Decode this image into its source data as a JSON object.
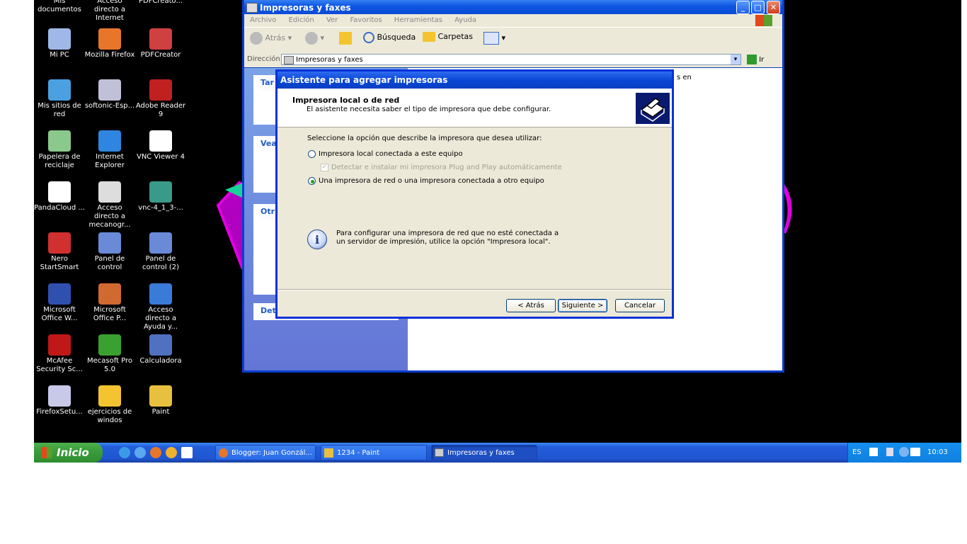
{
  "desktop": {
    "icons": [
      {
        "label": "Mis documentos",
        "icon": "my-documents-icon"
      },
      {
        "label": "Acceso directo a Internet",
        "icon": "internet-shortcut-icon"
      },
      {
        "label": "PDFCreato...",
        "icon": "pdfcreator-icon"
      },
      {
        "label": "Mi PC",
        "icon": "my-computer-icon"
      },
      {
        "label": "Mozilla Firefox",
        "icon": "firefox-icon"
      },
      {
        "label": "PDFCreator",
        "icon": "pdfcreator-icon"
      },
      {
        "label": "Mis sitios de red",
        "icon": "network-places-icon"
      },
      {
        "label": "softonic-Esp...",
        "icon": "installer-icon"
      },
      {
        "label": "Adobe Reader 9",
        "icon": "adobe-reader-icon"
      },
      {
        "label": "Papelera de reciclaje",
        "icon": "recycle-bin-icon"
      },
      {
        "label": "Internet Explorer",
        "icon": "internet-explorer-icon"
      },
      {
        "label": "VNC Viewer 4",
        "icon": "vnc-icon"
      },
      {
        "label": "PandaCloud ...",
        "icon": "panda-icon"
      },
      {
        "label": "Acceso directo a mecanogr...",
        "icon": "mecanografia-icon"
      },
      {
        "label": "vnc-4_1_3-...",
        "icon": "archive-icon"
      },
      {
        "label": "Nero StartSmart",
        "icon": "nero-icon"
      },
      {
        "label": "Panel de control",
        "icon": "control-panel-icon"
      },
      {
        "label": "Panel de control (2)",
        "icon": "control-panel-icon"
      },
      {
        "label": "Microsoft Office W...",
        "icon": "word-icon"
      },
      {
        "label": "Microsoft Office P...",
        "icon": "powerpoint-icon"
      },
      {
        "label": "Acceso directo a Ayuda y...",
        "icon": "help-icon"
      },
      {
        "label": "McAfee Security Sc...",
        "icon": "mcafee-icon"
      },
      {
        "label": "Mecasoft Pro 5.0",
        "icon": "tree-icon"
      },
      {
        "label": "Calculadora",
        "icon": "calculator-icon"
      },
      {
        "label": "FirefoxSetu...",
        "icon": "setup-cd-icon"
      },
      {
        "label": "ejercicios de windos",
        "icon": "folder-icon"
      },
      {
        "label": "Paint",
        "icon": "paint-icon"
      }
    ]
  },
  "explorer": {
    "title": "Impresoras y faxes",
    "menu": [
      "Archivo",
      "Edición",
      "Ver",
      "Favoritos",
      "Herramientas",
      "Ayuda"
    ],
    "toolbar": {
      "back": "Atrás",
      "search": "Búsqueda",
      "folders": "Carpetas"
    },
    "address_label": "Dirección",
    "address_value": "Impresoras y faxes",
    "go_label": "Ir",
    "panels": [
      "Tar",
      "Vea",
      "Otr",
      "Det"
    ],
    "right_text": "s en"
  },
  "wizard": {
    "title": "Asistente para agregar impresoras",
    "header_title": "Impresora local o de red",
    "header_subtitle": "El asistente necesita saber el tipo de impresora que debe configurar.",
    "prompt": "Seleccione la opción que describe la impresora que desea utilizar:",
    "option_local": "Impresora local conectada a este equipo",
    "option_pnp": "Detectar e instalar mi impresora Plug and Play automáticamente",
    "option_network": "Una impresora de red o una impresora conectada a otro equipo",
    "info_line1": "Para configurar una impresora de red que no esté conectada a",
    "info_line2": "un servidor de impresión, utilice la opción \"Impresora local\".",
    "btn_back": "< Atrás",
    "btn_next": "Siguiente >",
    "btn_cancel": "Cancelar"
  },
  "taskbar": {
    "start": "Inicio",
    "tasks": [
      "Blogger: Juan Gonzál...",
      "1234 - Paint",
      "Impresoras y faxes"
    ],
    "lang": "ES",
    "clock": "10:03"
  },
  "colors": {
    "accent": "#0a47d6",
    "start_green": "#3c9d3c",
    "magenta": "#d400d4"
  }
}
